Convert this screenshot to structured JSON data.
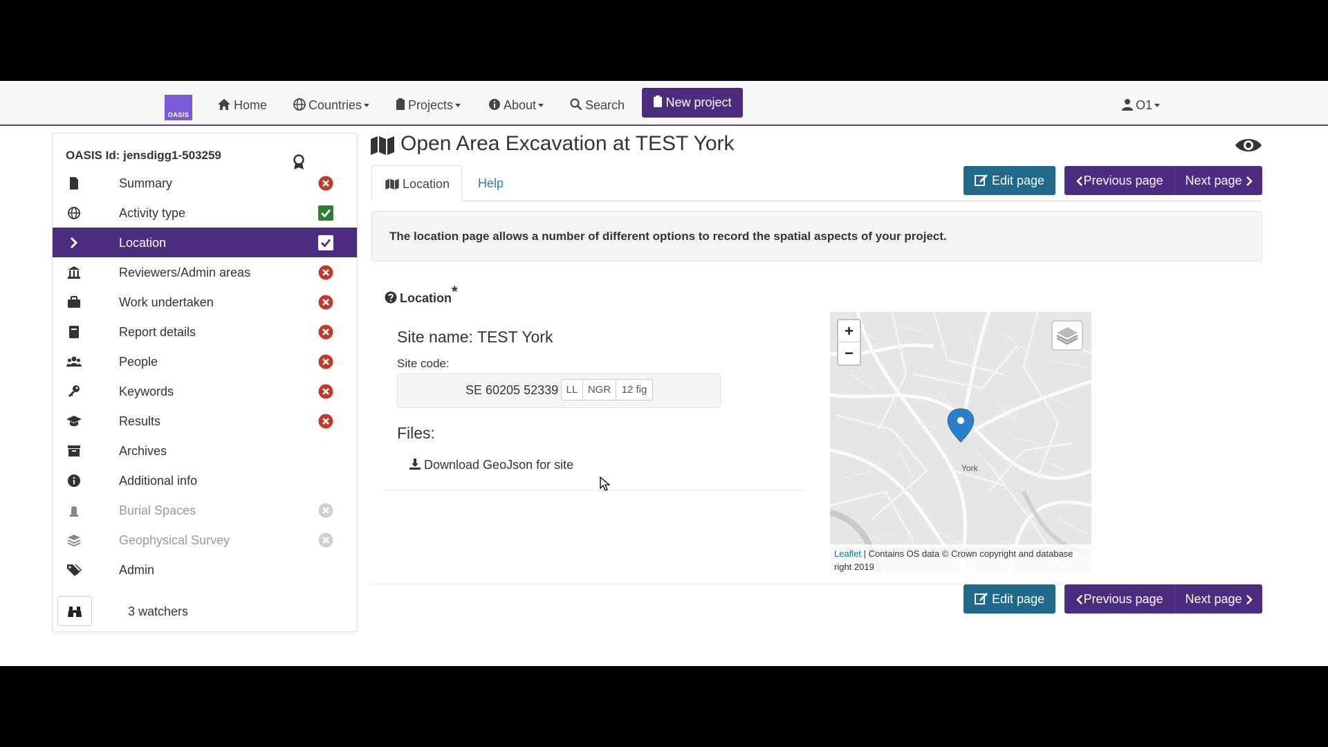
{
  "navbar": {
    "logo_text": "OASIS",
    "home": "Home",
    "countries": "Countries",
    "projects": "Projects",
    "about": "About",
    "search": "Search",
    "new_project": "New project",
    "user": "O1"
  },
  "sidebar": {
    "oasis_id": "OASIS Id: jensdigg1-503259",
    "items": [
      {
        "label": "Summary",
        "status": "incomplete"
      },
      {
        "label": "Activity type",
        "status": "complete"
      },
      {
        "label": "Location",
        "status": "complete",
        "active": true
      },
      {
        "label": "Reviewers/Admin areas",
        "status": "incomplete"
      },
      {
        "label": "Work undertaken",
        "status": "incomplete"
      },
      {
        "label": "Report details",
        "status": "incomplete"
      },
      {
        "label": "People",
        "status": "incomplete"
      },
      {
        "label": "Keywords",
        "status": "incomplete"
      },
      {
        "label": "Results",
        "status": "incomplete"
      },
      {
        "label": "Archives",
        "status": "none"
      },
      {
        "label": "Additional info",
        "status": "none"
      },
      {
        "label": "Burial Spaces",
        "status": "disabled"
      },
      {
        "label": "Geophysical Survey",
        "status": "disabled"
      },
      {
        "label": "Admin",
        "status": "none"
      }
    ],
    "watchers": "3 watchers"
  },
  "main": {
    "title": "Open Area Excavation at TEST York",
    "tabs": [
      {
        "label": "Location"
      },
      {
        "label": "Help"
      }
    ],
    "buttons": {
      "edit": "Edit page",
      "previous": "Previous page",
      "next": "Next page"
    },
    "info": "The location page allows a number of different options to record the spatial aspects of your project.",
    "location_heading": "Location",
    "location_required": "*",
    "site_name": "Site name: TEST York",
    "site_code_label": "Site code:",
    "site_code_value": "SE 60205 52339",
    "code_formats": [
      "LL",
      "NGR",
      "12 fig"
    ],
    "files_label": "Files:",
    "download_link": "Download GeoJson for site"
  },
  "map": {
    "zoom_in": "+",
    "zoom_out": "−",
    "place_label": "York",
    "attribution_link": "Leaflet",
    "attribution_text": " | Contains OS data © Crown copyright and database right 2019"
  },
  "colors": {
    "brand_purple": "#4b2c7f",
    "edit_teal": "#1f6a8a",
    "status_red": "#c0392b",
    "status_green": "#2e7d32",
    "marker_blue": "#2a81cb"
  }
}
